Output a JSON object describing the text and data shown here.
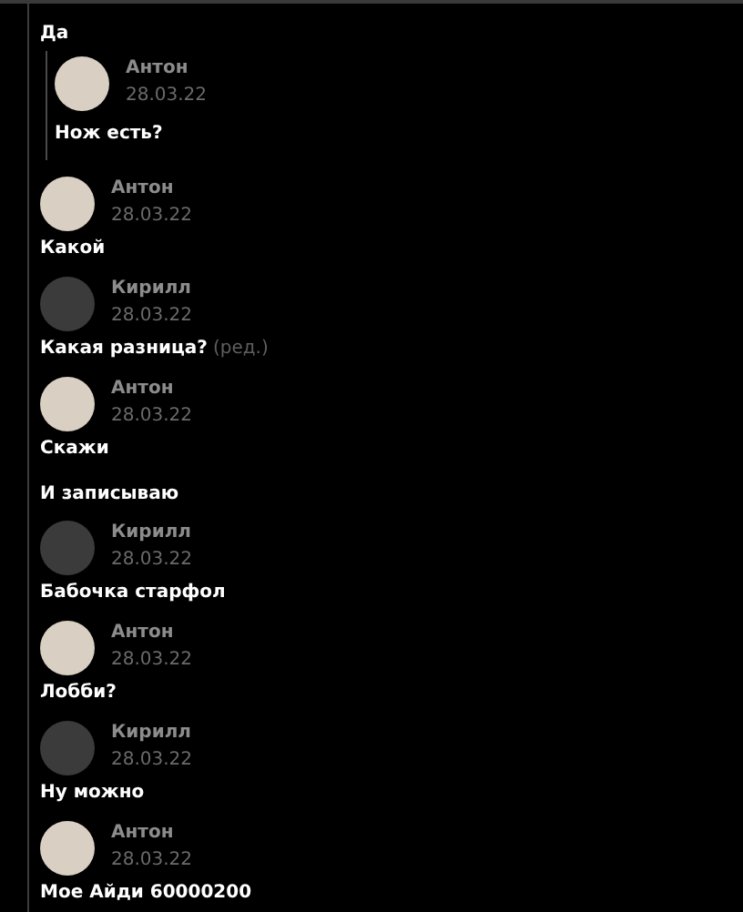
{
  "messages": [
    {
      "kind": "text",
      "text": "Да"
    },
    {
      "kind": "quote",
      "author": "Антон",
      "date": "28.03.22",
      "color": "#d9cfc2",
      "text": "Нож есть?"
    },
    {
      "kind": "message",
      "author": "Антон",
      "date": "28.03.22",
      "color": "#d9cfc2",
      "text": "Какой"
    },
    {
      "kind": "message",
      "author": "Кирилл",
      "date": "28.03.22",
      "color": "#3b3b3b",
      "text": "Какая разница?",
      "edited_label": "(ред.)"
    },
    {
      "kind": "message",
      "author": "Антон",
      "date": "28.03.22",
      "color": "#d9cfc2",
      "text": "Скажи"
    },
    {
      "kind": "text",
      "text": "И записываю"
    },
    {
      "kind": "message",
      "author": "Кирилл",
      "date": "28.03.22",
      "color": "#3b3b3b",
      "text": "Бабочка старфол"
    },
    {
      "kind": "message",
      "author": "Антон",
      "date": "28.03.22",
      "color": "#d9cfc2",
      "text": "Лобби?"
    },
    {
      "kind": "message",
      "author": "Кирилл",
      "date": "28.03.22",
      "color": "#3b3b3b",
      "text": "Ну можно"
    },
    {
      "kind": "message",
      "author": "Антон",
      "date": "28.03.22",
      "color": "#d9cfc2",
      "text": "Мое Айди 60000200"
    }
  ]
}
